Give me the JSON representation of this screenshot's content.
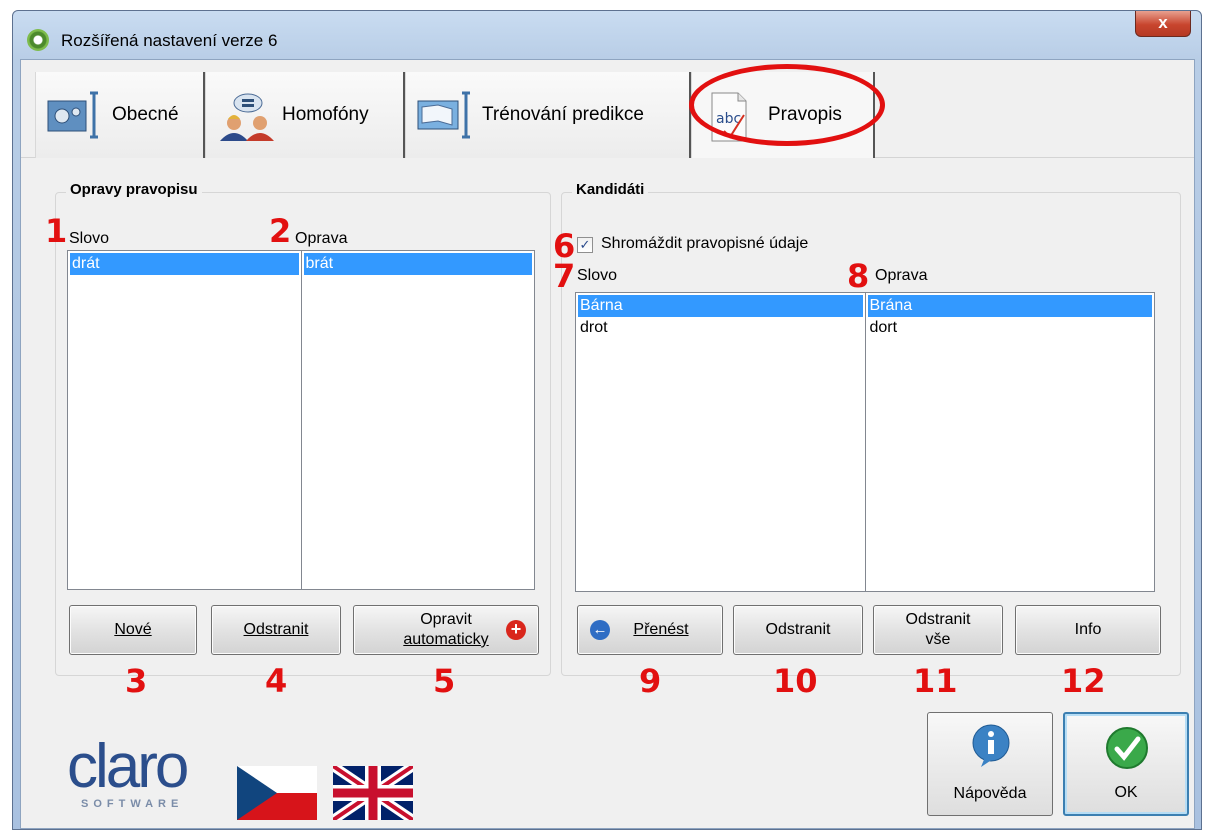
{
  "window": {
    "title": "Rozšířená nastavení verze 6",
    "close_label": "x"
  },
  "tabs": [
    {
      "label": "Obecné"
    },
    {
      "label": "Homofóny"
    },
    {
      "label": "Trénování predikce"
    },
    {
      "label": "Pravopis",
      "active": true
    }
  ],
  "corrections": {
    "title": "Opravy pravopisu",
    "col_word": "Slovo",
    "col_fix": "Oprava",
    "words": [
      "drát"
    ],
    "fixes": [
      "brát"
    ],
    "buttons": {
      "new": "Nové",
      "remove": "Odstranit",
      "autofix_line1": "Opravit",
      "autofix_line2": "automaticky"
    }
  },
  "candidates": {
    "title": "Kandidáti",
    "collect_label": "Shromáždit pravopisné údaje",
    "collect_checked": true,
    "col_word": "Slovo",
    "col_fix": "Oprava",
    "words": [
      "Bárna",
      "drot"
    ],
    "fixes": [
      "Brána",
      "dort"
    ],
    "buttons": {
      "transfer": "Přenést",
      "remove": "Odstranit",
      "remove_all_line1": "Odstranit",
      "remove_all_line2": "vše",
      "info": "Info"
    }
  },
  "markers": [
    "1",
    "2",
    "3",
    "4",
    "5",
    "6",
    "7",
    "8",
    "9",
    "10",
    "11",
    "12"
  ],
  "logo": {
    "main": "claro",
    "sub": "SOFTWARE"
  },
  "footer": {
    "help_label": "Nápověda",
    "ok_label": "OK"
  },
  "colors": {
    "selection": "#3399ff",
    "marker": "#e21010",
    "accent": "#2b4e8c"
  }
}
